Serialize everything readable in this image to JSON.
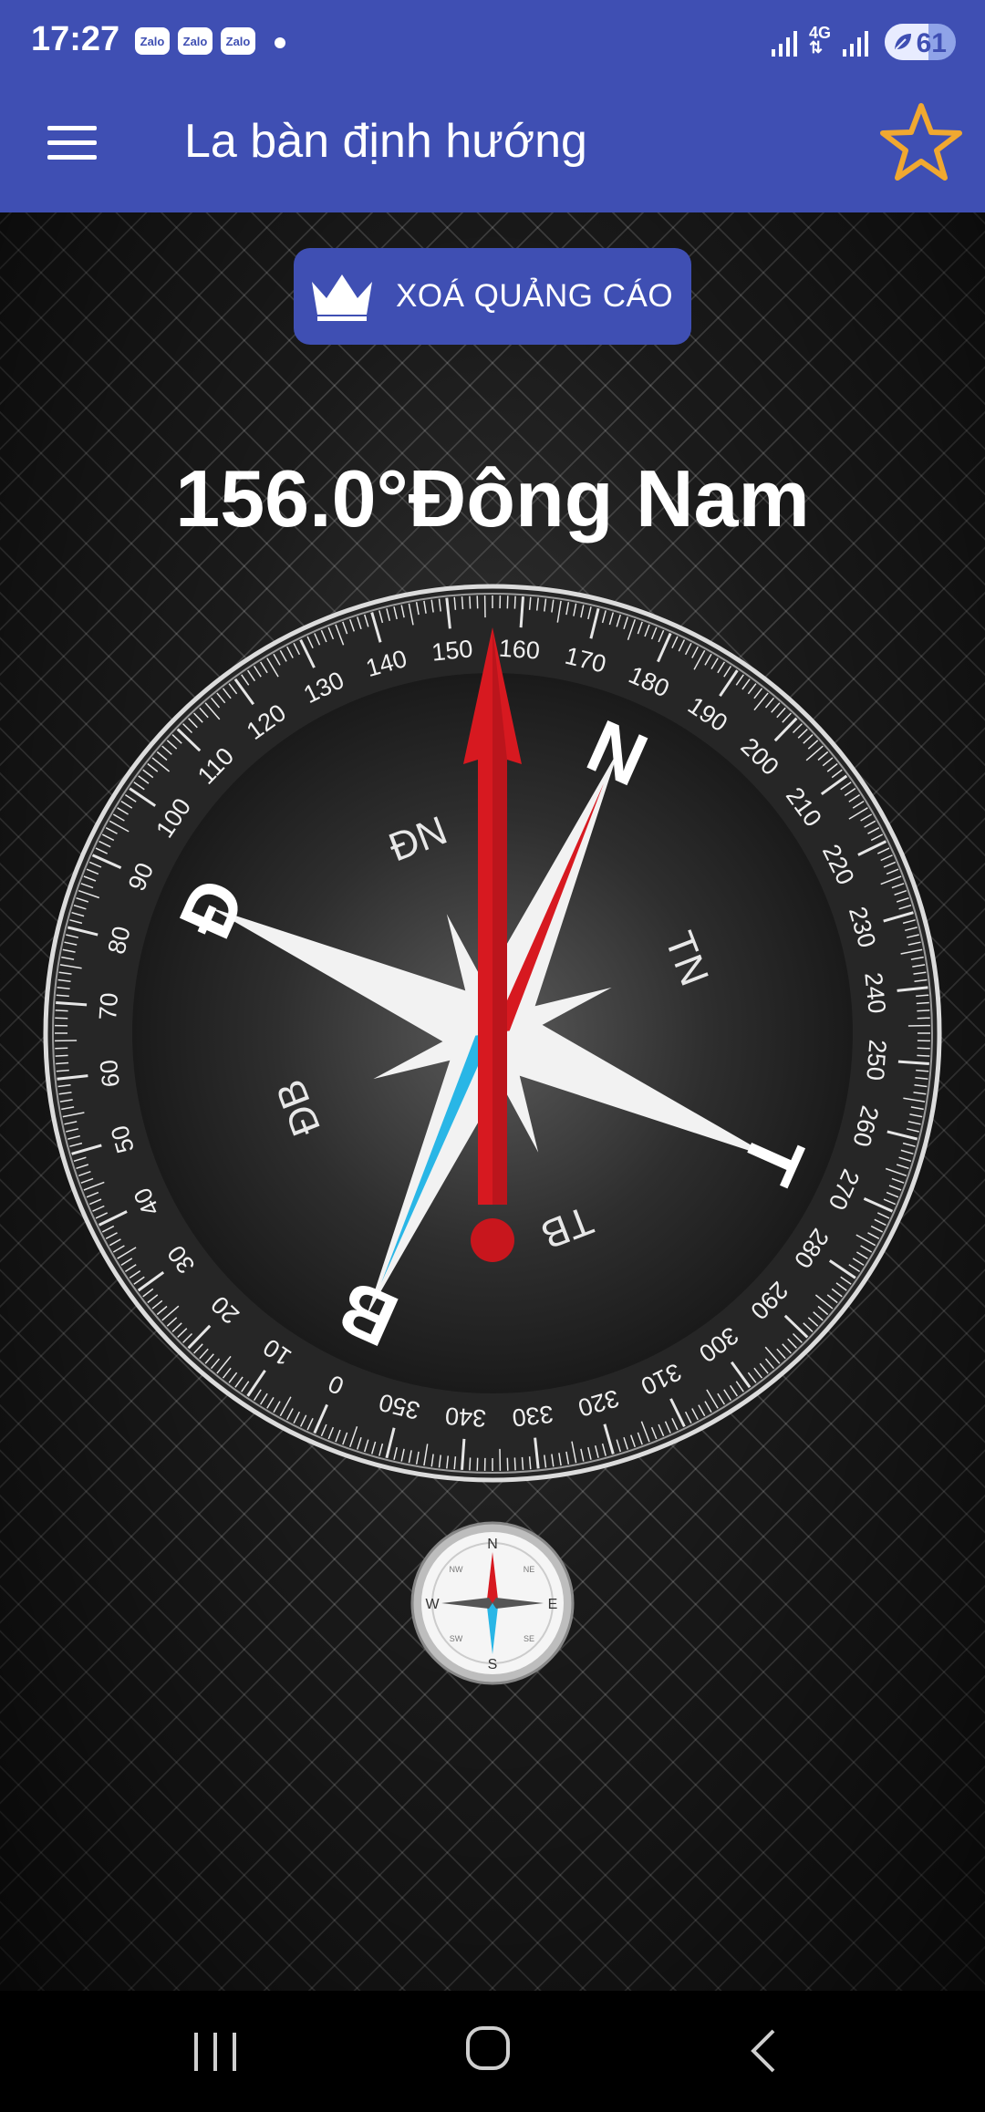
{
  "status_bar": {
    "time": "17:27",
    "notifications": [
      "Zalo",
      "Zalo",
      "Zalo"
    ],
    "network_label": "4G",
    "battery_percent": 61,
    "battery_text": "61"
  },
  "app_bar": {
    "title": "La bàn định hướng",
    "menu_icon": "hamburger-menu-icon",
    "favorite_icon": "star-outline-icon"
  },
  "remove_ads": {
    "label": "XOÁ QUẢNG CÁO",
    "icon": "crown-icon"
  },
  "heading": {
    "degrees": 156.0,
    "direction": "Đông Nam",
    "text": "156.0°Đông Nam"
  },
  "compass": {
    "rotation_deg": 156,
    "cardinals": [
      {
        "label": "B",
        "bearing": 0
      },
      {
        "label": "Đ",
        "bearing": 90
      },
      {
        "label": "N",
        "bearing": 180
      },
      {
        "label": "T",
        "bearing": 270
      }
    ],
    "intercardinals": [
      {
        "label": "ĐB",
        "bearing": 45
      },
      {
        "label": "ĐN",
        "bearing": 135
      },
      {
        "label": "TN",
        "bearing": 225
      },
      {
        "label": "TB",
        "bearing": 315
      }
    ],
    "degree_labels": [
      "0",
      "10",
      "20",
      "30",
      "40",
      "50",
      "60",
      "70",
      "80",
      "90",
      "100",
      "110",
      "120",
      "130",
      "140",
      "150",
      "160",
      "170",
      "180",
      "190",
      "200",
      "210",
      "220",
      "230",
      "240",
      "250",
      "260",
      "270",
      "280",
      "290",
      "300",
      "310",
      "320",
      "330",
      "340",
      "350"
    ],
    "colors": {
      "needle": "#d71920",
      "needle_cyan": "#29b6e6",
      "star": "#f2f2f2",
      "dial_ring": "#cfcfcf"
    }
  },
  "mini_compass": {
    "labels": [
      "N",
      "E",
      "S",
      "W"
    ],
    "intercardinals": [
      "NE",
      "SE",
      "SW",
      "NW"
    ]
  },
  "nav_bar": {
    "recent_icon": "recent-apps-icon",
    "home_icon": "home-icon",
    "back_icon": "back-icon"
  },
  "colors": {
    "primary": "#3f4fb3",
    "accent_star": "#f0a830"
  }
}
